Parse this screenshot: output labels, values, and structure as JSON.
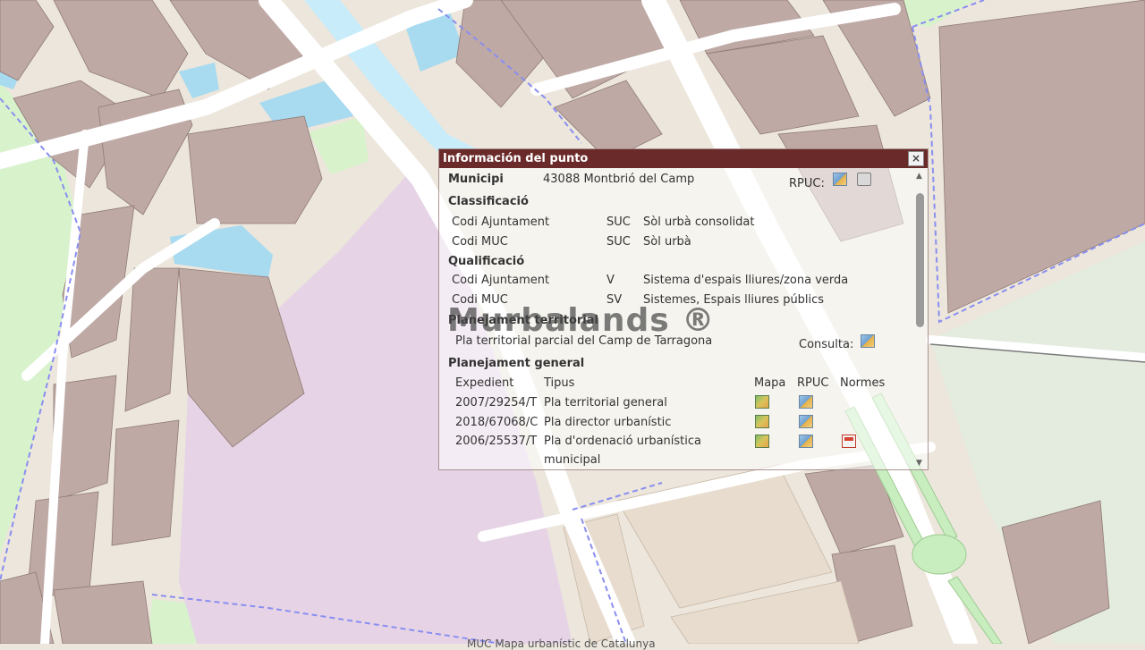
{
  "popup": {
    "title": "Información del punto",
    "close_label": "×",
    "municipi_label": "Municipi",
    "municipi_value": "43088 Montbrió del Camp",
    "rpuc_label": "RPUC:",
    "classificacio": {
      "heading": "Classificació",
      "rows": [
        {
          "label": "Codi Ajuntament",
          "code": "SUC",
          "desc": "Sòl urbà consolidat"
        },
        {
          "label": "Codi MUC",
          "code": "SUC",
          "desc": "Sòl urbà"
        }
      ]
    },
    "qualificacio": {
      "heading": "Qualificació",
      "rows": [
        {
          "label": "Codi Ajuntament",
          "code": "V",
          "desc": "Sistema d'espais lliures/zona verda"
        },
        {
          "label": "Codi MUC",
          "code": "SV",
          "desc": "Sistemes, Espais lliures públics"
        }
      ]
    },
    "territorial": {
      "heading": "Planejament territorial",
      "plan": "Pla territorial parcial del Camp de Tarragona",
      "consulta_label": "Consulta:"
    },
    "general": {
      "heading": "Planejament general",
      "col_expedient": "Expedient",
      "col_tipus": "Tipus",
      "col_mapa": "Mapa",
      "col_rpuc": "RPUC",
      "col_normes": "Normes",
      "rows": [
        {
          "expedient": "2007/29254/T",
          "tipus": "Pla territorial general",
          "tipus2": ""
        },
        {
          "expedient": "2018/67068/C",
          "tipus": "Pla director urbanístic",
          "tipus2": ""
        },
        {
          "expedient": "2006/25537/T",
          "tipus": "Pla d'ordenació urbanística",
          "tipus2": "municipal"
        }
      ]
    }
  },
  "watermark": "Murbalands ®",
  "bottom_text": "MUC Mapa urbanístic de Catalunya"
}
